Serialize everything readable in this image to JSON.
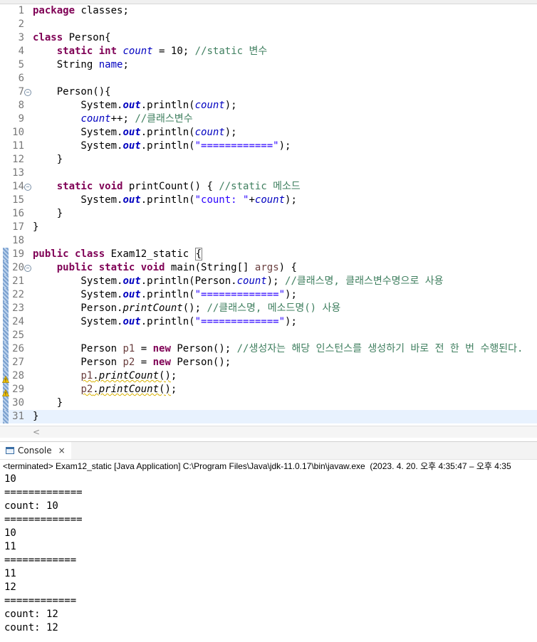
{
  "editor": {
    "lines": [
      {
        "num": "1",
        "segs": [
          {
            "c": "kw",
            "t": "package"
          },
          {
            "t": " classes;"
          }
        ]
      },
      {
        "num": "2",
        "segs": []
      },
      {
        "num": "3",
        "segs": [
          {
            "c": "kw",
            "t": "class"
          },
          {
            "t": " Person{"
          }
        ]
      },
      {
        "num": "4",
        "segs": [
          {
            "t": "    "
          },
          {
            "c": "kw",
            "t": "static"
          },
          {
            "t": " "
          },
          {
            "c": "kw",
            "t": "int"
          },
          {
            "t": " "
          },
          {
            "c": "fld",
            "t": "count"
          },
          {
            "t": " = 10; "
          },
          {
            "c": "cmt",
            "t": "//static 변수"
          }
        ]
      },
      {
        "num": "5",
        "segs": [
          {
            "t": "    String "
          },
          {
            "c": "ifld",
            "t": "name"
          },
          {
            "t": ";"
          }
        ]
      },
      {
        "num": "6",
        "segs": []
      },
      {
        "num": "7",
        "fold": true,
        "segs": [
          {
            "t": "    Person(){"
          }
        ]
      },
      {
        "num": "8",
        "segs": [
          {
            "t": "        System."
          },
          {
            "c": "sfld",
            "t": "out"
          },
          {
            "t": ".println("
          },
          {
            "c": "fld",
            "t": "count"
          },
          {
            "t": ");"
          }
        ]
      },
      {
        "num": "9",
        "segs": [
          {
            "t": "        "
          },
          {
            "c": "fld",
            "t": "count"
          },
          {
            "t": "++; "
          },
          {
            "c": "cmt",
            "t": "//클래스변수"
          }
        ]
      },
      {
        "num": "10",
        "segs": [
          {
            "t": "        System."
          },
          {
            "c": "sfld",
            "t": "out"
          },
          {
            "t": ".println("
          },
          {
            "c": "fld",
            "t": "count"
          },
          {
            "t": ");"
          }
        ]
      },
      {
        "num": "11",
        "segs": [
          {
            "t": "        System."
          },
          {
            "c": "sfld",
            "t": "out"
          },
          {
            "t": ".println("
          },
          {
            "c": "str",
            "t": "\"============\""
          },
          {
            "t": ");"
          }
        ]
      },
      {
        "num": "12",
        "segs": [
          {
            "t": "    }"
          }
        ]
      },
      {
        "num": "13",
        "segs": []
      },
      {
        "num": "14",
        "fold": true,
        "segs": [
          {
            "t": "    "
          },
          {
            "c": "kw",
            "t": "static"
          },
          {
            "t": " "
          },
          {
            "c": "kw",
            "t": "void"
          },
          {
            "t": " printCount() { "
          },
          {
            "c": "cmt",
            "t": "//static 메소드"
          }
        ]
      },
      {
        "num": "15",
        "segs": [
          {
            "t": "        System."
          },
          {
            "c": "sfld",
            "t": "out"
          },
          {
            "t": ".println("
          },
          {
            "c": "str",
            "t": "\"count: \""
          },
          {
            "t": "+"
          },
          {
            "c": "fld",
            "t": "count"
          },
          {
            "t": ");"
          }
        ]
      },
      {
        "num": "16",
        "segs": [
          {
            "t": "    }"
          }
        ]
      },
      {
        "num": "17",
        "segs": [
          {
            "t": "}"
          }
        ]
      },
      {
        "num": "18",
        "segs": []
      },
      {
        "num": "19",
        "marker": true,
        "segs": [
          {
            "c": "kw",
            "t": "public"
          },
          {
            "t": " "
          },
          {
            "c": "kw",
            "t": "class"
          },
          {
            "t": " Exam12_static "
          },
          {
            "c": "bracketbox",
            "t": "{"
          }
        ]
      },
      {
        "num": "20",
        "marker": true,
        "fold": true,
        "segs": [
          {
            "t": "    "
          },
          {
            "c": "kw",
            "t": "public"
          },
          {
            "t": " "
          },
          {
            "c": "kw",
            "t": "static"
          },
          {
            "t": " "
          },
          {
            "c": "kw",
            "t": "void"
          },
          {
            "t": " main(String[] "
          },
          {
            "c": "var",
            "t": "args"
          },
          {
            "t": ") {"
          }
        ]
      },
      {
        "num": "21",
        "marker": true,
        "segs": [
          {
            "t": "        System."
          },
          {
            "c": "sfld",
            "t": "out"
          },
          {
            "t": ".println(Person."
          },
          {
            "c": "fld",
            "t": "count"
          },
          {
            "t": "); "
          },
          {
            "c": "cmt",
            "t": "//클래스명, 클래스변수명으로 사용"
          }
        ]
      },
      {
        "num": "22",
        "marker": true,
        "segs": [
          {
            "t": "        System."
          },
          {
            "c": "sfld",
            "t": "out"
          },
          {
            "t": ".println("
          },
          {
            "c": "str",
            "t": "\"=============\""
          },
          {
            "t": ");"
          }
        ]
      },
      {
        "num": "23",
        "marker": true,
        "segs": [
          {
            "t": "        Person."
          },
          {
            "c": "smeth",
            "t": "printCount"
          },
          {
            "t": "(); "
          },
          {
            "c": "cmt",
            "t": "//클래스명, 메소드명() 사용"
          }
        ]
      },
      {
        "num": "24",
        "marker": true,
        "segs": [
          {
            "t": "        System."
          },
          {
            "c": "sfld",
            "t": "out"
          },
          {
            "t": ".println("
          },
          {
            "c": "str",
            "t": "\"=============\""
          },
          {
            "t": ");"
          }
        ]
      },
      {
        "num": "25",
        "marker": true,
        "segs": []
      },
      {
        "num": "26",
        "marker": true,
        "segs": [
          {
            "t": "        Person "
          },
          {
            "c": "var",
            "t": "p1"
          },
          {
            "t": " = "
          },
          {
            "c": "kw",
            "t": "new"
          },
          {
            "t": " Person(); "
          },
          {
            "c": "cmt",
            "t": "//생성자는 해당 인스턴스를 생성하기 바로 전 한 번 수행된다."
          }
        ]
      },
      {
        "num": "27",
        "marker": true,
        "segs": [
          {
            "t": "        Person "
          },
          {
            "c": "var",
            "t": "p2"
          },
          {
            "t": " = "
          },
          {
            "c": "kw",
            "t": "new"
          },
          {
            "t": " Person();"
          }
        ]
      },
      {
        "num": "28",
        "marker": true,
        "warn": true,
        "segs": [
          {
            "t": "        "
          },
          {
            "c": "var squig",
            "t": "p1"
          },
          {
            "c": "squig",
            "t": "."
          },
          {
            "c": "smeth squig",
            "t": "printCount"
          },
          {
            "c": "squig",
            "t": "()"
          },
          {
            "t": ";"
          }
        ]
      },
      {
        "num": "29",
        "marker": true,
        "warn": true,
        "segs": [
          {
            "t": "        "
          },
          {
            "c": "var squig",
            "t": "p2"
          },
          {
            "c": "squig",
            "t": "."
          },
          {
            "c": "smeth squig",
            "t": "printCount"
          },
          {
            "c": "squig",
            "t": "()"
          },
          {
            "t": ";"
          }
        ]
      },
      {
        "num": "30",
        "marker": true,
        "segs": [
          {
            "t": "    }"
          }
        ]
      },
      {
        "num": "31",
        "marker": true,
        "current": true,
        "segs": [
          {
            "t": "}"
          }
        ]
      }
    ]
  },
  "console_tab": {
    "label": "Console",
    "close": "×"
  },
  "status_line": "<terminated> Exam12_static [Java Application] C:\\Program Files\\Java\\jdk-11.0.17\\bin\\javaw.exe  (2023. 4. 20. 오후 4:35:47 – 오후 4:35",
  "console_output": [
    "10",
    "=============",
    "count: 10",
    "=============",
    "10",
    "11",
    "============",
    "11",
    "12",
    "============",
    "count: 12",
    "count: 12"
  ],
  "colors": {
    "keyword": "#7f0055",
    "field": "#0000c0",
    "string": "#2a00ff",
    "comment": "#3f7f5f",
    "local_var": "#6a3e3e",
    "current_line": "#e8f2fe"
  }
}
